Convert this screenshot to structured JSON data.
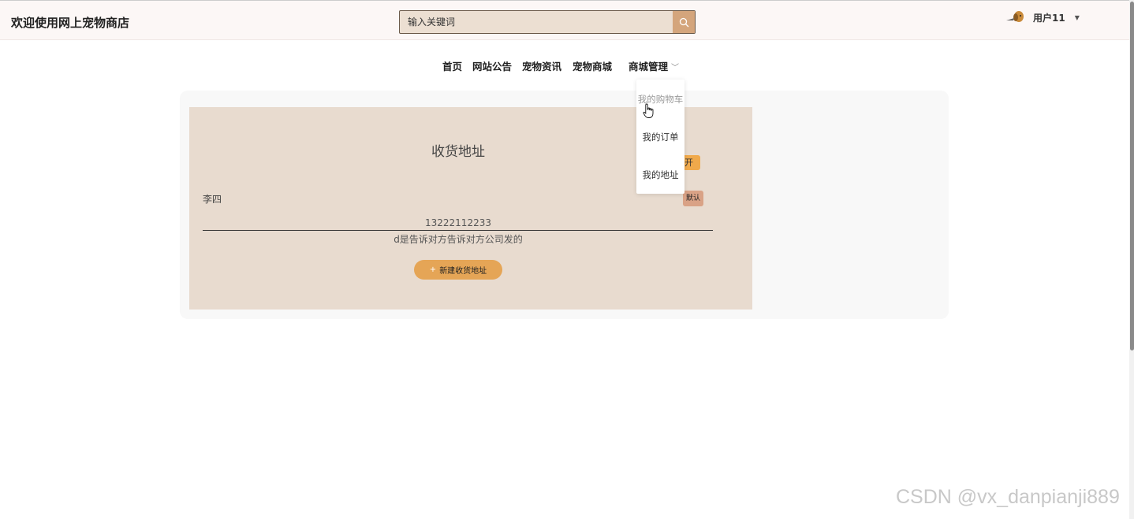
{
  "header": {
    "site_title": "欢迎使用网上宠物商店",
    "search_placeholder": "输入关键词",
    "user_name": "用户11"
  },
  "nav": {
    "items": [
      "首页",
      "网站公告",
      "宠物资讯",
      "宠物商城",
      "商城管理"
    ]
  },
  "dropdown": {
    "items": [
      "我的购物车",
      "我的订单",
      "我的地址"
    ]
  },
  "address_page": {
    "title": "收货地址",
    "edit_button_partial": "开",
    "default_badge": "默认",
    "address": {
      "name": "李四",
      "phone": "13222112233",
      "detail": "d是告诉对方告诉对方公司发的"
    },
    "new_button_label": "新建收货地址"
  },
  "watermark": "CSDN @vx_danpianji889",
  "colors": {
    "accent_orange": "#e5a556",
    "card_bg": "#e8dbcf",
    "search_button": "#d4a57c"
  }
}
